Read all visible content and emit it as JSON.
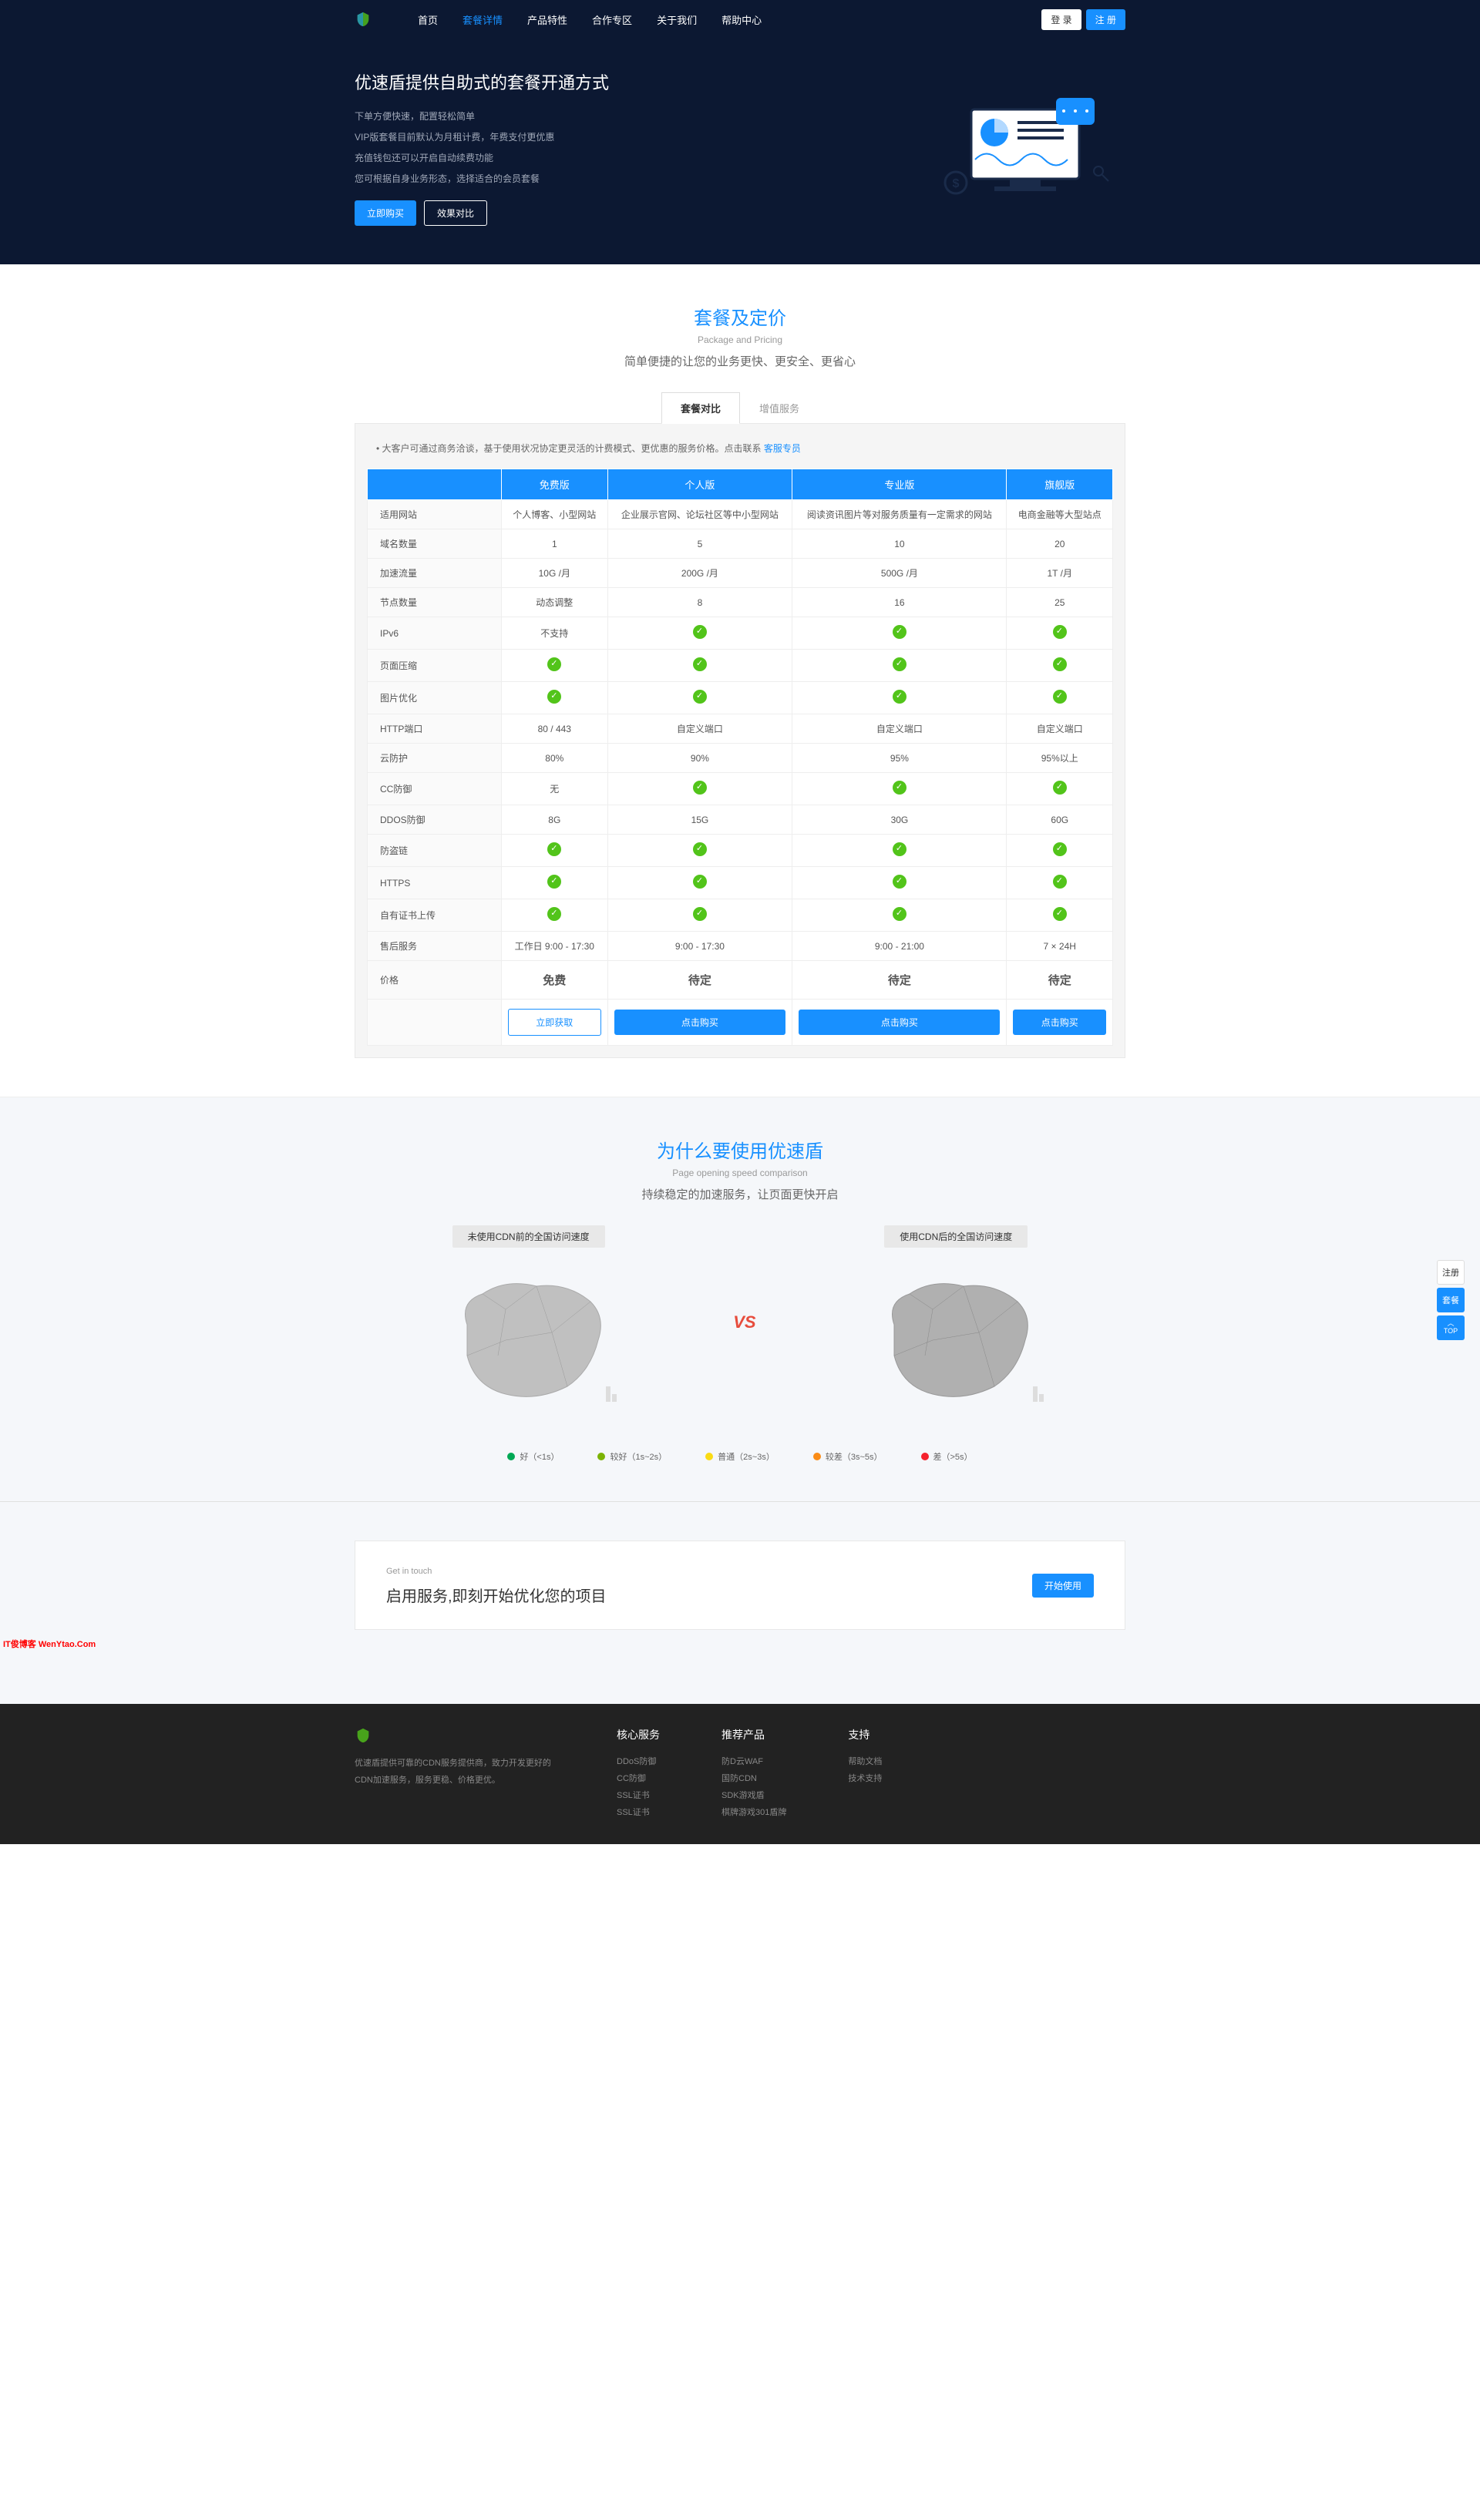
{
  "nav": {
    "items": [
      "首页",
      "套餐详情",
      "产品特性",
      "合作专区",
      "关于我们",
      "帮助中心"
    ],
    "login": "登 录",
    "register": "注 册"
  },
  "hero": {
    "title": "优速盾提供自助式的套餐开通方式",
    "lines": [
      "下单方便快速，配置轻松简单",
      "VIP版套餐目前默认为月租计费，年费支付更优惠",
      "充值钱包还可以开启自动续费功能",
      "您可根据自身业务形态，选择适合的会员套餐"
    ],
    "buy": "立即购买",
    "compare": "效果对比"
  },
  "pricing": {
    "title": "套餐及定价",
    "sub": "Package and Pricing",
    "desc": "简单便捷的让您的业务更快、更安全、更省心",
    "tabs": [
      "套餐对比",
      "增值服务"
    ],
    "notice_prefix": "• 大客户可通过商务洽谈，基于使用状况协定更灵活的计费模式、更优惠的服务价格。点击联系 ",
    "notice_link": "客服专员",
    "plans": [
      "免费版",
      "个人版",
      "专业版",
      "旗舰版"
    ],
    "rows": [
      {
        "label": "适用网站",
        "cells": [
          "个人博客、小型网站",
          "企业展示官网、论坛社区等中小型网站",
          "阅读资讯图片等对服务质量有一定需求的网站",
          "电商金融等大型站点"
        ]
      },
      {
        "label": "域名数量",
        "cells": [
          "1",
          "5",
          "10",
          "20"
        ]
      },
      {
        "label": "加速流量",
        "cells": [
          "10G /月",
          "200G /月",
          "500G /月",
          "1T /月"
        ]
      },
      {
        "label": "节点数量",
        "cells": [
          "动态调整",
          "8",
          "16",
          "25"
        ]
      },
      {
        "label": "IPv6",
        "cells": [
          "不支持",
          "check",
          "check",
          "check"
        ]
      },
      {
        "label": "页面压缩",
        "cells": [
          "check",
          "check",
          "check",
          "check"
        ]
      },
      {
        "label": "图片优化",
        "cells": [
          "check",
          "check",
          "check",
          "check"
        ]
      },
      {
        "label": "HTTP端口",
        "cells": [
          "80 / 443",
          "自定义端口",
          "自定义端口",
          "自定义端口"
        ]
      },
      {
        "label": "云防护",
        "cells": [
          "80%",
          "90%",
          "95%",
          "95%以上"
        ]
      },
      {
        "label": "CC防御",
        "cells": [
          "无",
          "check",
          "check",
          "check"
        ]
      },
      {
        "label": "DDOS防御",
        "cells": [
          "8G",
          "15G",
          "30G",
          "60G"
        ]
      },
      {
        "label": "防盗链",
        "cells": [
          "check",
          "check",
          "check",
          "check"
        ]
      },
      {
        "label": "HTTPS",
        "cells": [
          "check",
          "check",
          "check",
          "check"
        ]
      },
      {
        "label": "自有证书上传",
        "cells": [
          "check",
          "check",
          "check",
          "check"
        ]
      },
      {
        "label": "售后服务",
        "cells": [
          "工作日 9:00 - 17:30",
          "9:00 - 17:30",
          "9:00 - 21:00",
          "7 × 24H"
        ]
      }
    ],
    "price_label": "价格",
    "prices": [
      "免费",
      "待定",
      "待定",
      "待定"
    ],
    "get_btn": "立即获取",
    "buy_btn": "点击购买"
  },
  "why": {
    "title": "为什么要使用优速盾",
    "sub": "Page opening speed comparison",
    "desc": "持续稳定的加速服务，让页面更快开启",
    "before": "未使用CDN前的全国访问速度",
    "after": "使用CDN后的全国访问速度",
    "vs": "VS",
    "legend": [
      {
        "color": "#00a854",
        "label": "好（<1s）"
      },
      {
        "color": "#7cb305",
        "label": "较好（1s~2s）"
      },
      {
        "color": "#fadb14",
        "label": "普通（2s~3s）"
      },
      {
        "color": "#fa8c16",
        "label": "较差（3s~5s）"
      },
      {
        "color": "#f5222d",
        "label": "差（>5s）"
      }
    ]
  },
  "cta": {
    "small": "Get in touch",
    "title": "启用服务,即刻开始优化您的项目",
    "btn": "开始使用"
  },
  "watermark": "IT俊博客 WenYtao.Com",
  "footer": {
    "about": "优速盾提供可靠的CDN服务提供商，致力开发更好的CDN加速服务，服务更稳、价格更优。",
    "cols": [
      {
        "title": "核心服务",
        "links": [
          "DDoS防御",
          "CC防御",
          "SSL证书",
          "SSL证书"
        ]
      },
      {
        "title": "推荐产品",
        "links": [
          "防D云WAF",
          "国防CDN",
          "SDK游戏盾",
          "棋牌游戏301盾牌"
        ]
      },
      {
        "title": "支持",
        "links": [
          "帮助文档",
          "技术支持"
        ]
      }
    ]
  },
  "float": {
    "reg": "注册",
    "pkg": "套餐",
    "top": "TOP"
  }
}
